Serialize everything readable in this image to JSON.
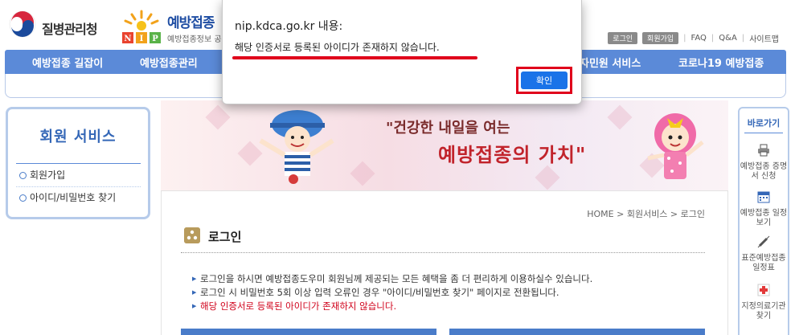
{
  "header": {
    "kdca_name": "질병관리청",
    "nip_title": "예방접종",
    "nip_subtitle": "예방접종정보 공",
    "util": {
      "login": "로그인",
      "join": "회원가입",
      "faq": "FAQ",
      "qna": "Q&A",
      "sitemap": "사이트맵"
    }
  },
  "gnb": {
    "items": [
      "예방접종 길잡이",
      "예방접종관리",
      "자민원 서비스",
      "코로나19 예방접종"
    ]
  },
  "lnb": {
    "title": "회원 서비스",
    "items": [
      {
        "label": "회원가입"
      },
      {
        "label": "아이디/비밀번호 찾기"
      }
    ]
  },
  "banner": {
    "line1": "\"건강한 내일을 여는",
    "line2": "예방접종의 가치\""
  },
  "quick": {
    "title": "바로가기",
    "items": [
      {
        "label": "예방접종 증명서 신청",
        "icon": "printer-icon"
      },
      {
        "label": "예방접종 일정보기",
        "icon": "calendar-icon"
      },
      {
        "label": "표준예방접종 일정표",
        "icon": "syringe-icon"
      },
      {
        "label": "지정의료기관 찾기",
        "icon": "hospital-icon"
      }
    ]
  },
  "content": {
    "breadcrumb": "HOME > 회원서비스 > 로그인",
    "title": "로그인",
    "notes": [
      "로그인을 하시면 예방접종도우미 회원님께 제공되는 모든 혜택을 좀 더 편리하게 이용하실수 있습니다.",
      "로그인 시 비밀번호 5회 이상 입력 오류인 경우 \"아이디/비밀번호 찾기\" 페이지로 전환됩니다.",
      "해당 인증서로 등록된 아이디가 존재하지 않습니다."
    ]
  },
  "dialog": {
    "title": "nip.kdca.go.kr 내용:",
    "message": "해당 인증서로 등록된 아이디가 존재하지 않습니다.",
    "ok_label": "확인"
  },
  "colors": {
    "nav_blue": "#5b8ad8",
    "accent_red": "#e0001b",
    "button_blue": "#1a73e8"
  }
}
